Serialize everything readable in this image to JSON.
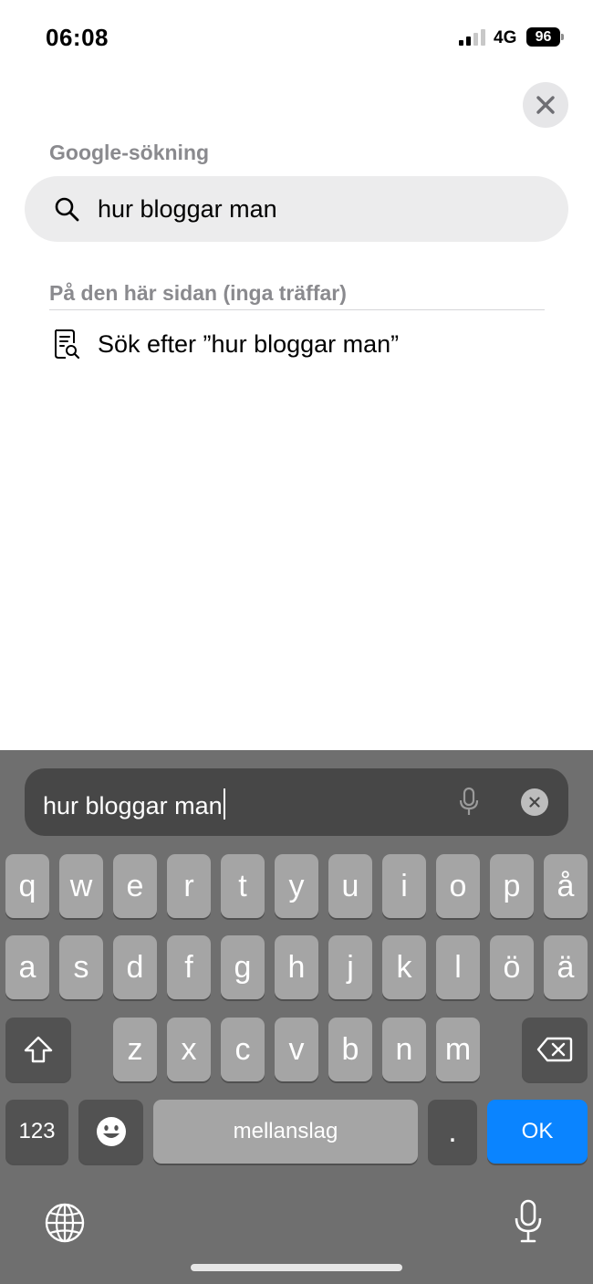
{
  "status_bar": {
    "time": "06:08",
    "network": "4G",
    "battery": "96"
  },
  "search_panel": {
    "google_header": "Google-sökning",
    "google_suggestion": "hur bloggar man",
    "on_page_header": "På den här sidan (inga träffar)",
    "find_on_page": "Sök efter ”hur bloggar man”"
  },
  "keyboard": {
    "query": "hur bloggar man",
    "row1": [
      "q",
      "w",
      "e",
      "r",
      "t",
      "y",
      "u",
      "i",
      "o",
      "p",
      "å"
    ],
    "row2": [
      "a",
      "s",
      "d",
      "f",
      "g",
      "h",
      "j",
      "k",
      "l",
      "ö",
      "ä"
    ],
    "row3": [
      "z",
      "x",
      "c",
      "v",
      "b",
      "n",
      "m"
    ],
    "numbers_label": "123",
    "space_label": "mellanslag",
    "period_label": ".",
    "ok_label": "OK"
  },
  "icons": {
    "close": "close-icon",
    "search": "search-icon",
    "find_in_page": "find-in-page-icon",
    "microphone": "microphone-icon",
    "clear": "clear-icon",
    "shift": "shift-icon",
    "backspace": "backspace-icon",
    "emoji": "emoji-icon",
    "globe": "globe-icon"
  },
  "colors": {
    "accent": "#0a84ff",
    "keyboard_bg": "#6f6f6f",
    "key": "#a5a5a5",
    "key_dark": "#525252",
    "pill": "#ececed",
    "header_gray": "#8a8a8e"
  }
}
